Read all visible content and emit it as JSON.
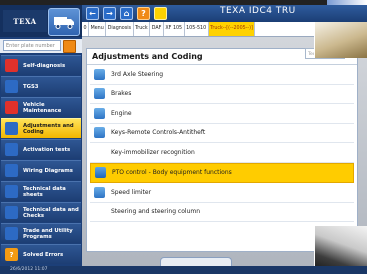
{
  "app": {
    "logo_text": "TEXA",
    "title": "TEXA IDC4 TRU"
  },
  "sidebar": {
    "plate_placeholder": "Enter plate number",
    "items": [
      {
        "label": "Self-diagnosis",
        "icon": "stethoscope-icon",
        "color": "#e0312b",
        "active": false
      },
      {
        "label": "TGS3",
        "icon": "tgs3-icon",
        "color": "#2d6ac4",
        "active": false
      },
      {
        "label": "Vehicle Maintenance",
        "icon": "wrench-icon",
        "color": "#e0312b",
        "active": false
      },
      {
        "label": "Adjustments and Coding",
        "icon": "adjust-icon",
        "color": "#2d6ac4",
        "active": true
      },
      {
        "label": "Activation tests",
        "icon": "activation-icon",
        "color": "#2d6ac4",
        "active": false
      },
      {
        "label": "Wiring Diagrams",
        "icon": "wiring-icon",
        "color": "#2d6ac4",
        "active": false
      },
      {
        "label": "Technical data sheets",
        "icon": "datasheet-icon",
        "color": "#2d6ac4",
        "active": false
      },
      {
        "label": "Technical data and Checks",
        "icon": "checks-icon",
        "color": "#2d6ac4",
        "active": false
      },
      {
        "label": "Trade and Utility Programs",
        "icon": "utility-icon",
        "color": "#2d6ac4",
        "active": false
      },
      {
        "label": "Solved Errors",
        "icon": "question-icon",
        "color": "#f39a13",
        "active": false
      }
    ]
  },
  "breadcrumb": [
    {
      "label": "0",
      "highlight": false
    },
    {
      "label": "Menu",
      "highlight": false
    },
    {
      "label": "Diagnosis",
      "highlight": false
    },
    {
      "label": "Truck",
      "highlight": false
    },
    {
      "label": "DAF",
      "highlight": false
    },
    {
      "label": "XF 105",
      "highlight": false
    },
    {
      "label": "105-510",
      "highlight": false
    },
    {
      "label": "Truck--[(--2005--)]",
      "highlight": true
    }
  ],
  "content": {
    "title": "Adjustments and Coding",
    "search_placeholder": "Text search",
    "rows": [
      {
        "label": "3rd Axle Steering",
        "icon": true,
        "selected": false
      },
      {
        "label": "Brakes",
        "icon": true,
        "selected": false
      },
      {
        "label": "Engine",
        "icon": true,
        "selected": false
      },
      {
        "label": "Keys-Remote Controls-Antitheft",
        "icon": true,
        "selected": false
      },
      {
        "label": "Key-immobilizer recognition",
        "icon": false,
        "selected": false
      },
      {
        "label": "PTO control - Body equipment functions",
        "icon": true,
        "selected": true
      },
      {
        "label": "Speed limiter",
        "icon": true,
        "selected": false
      },
      {
        "label": "Steering and steering column",
        "icon": false,
        "selected": false
      }
    ]
  },
  "statusbar": {
    "datetime": "26/6/2012 11:07"
  }
}
